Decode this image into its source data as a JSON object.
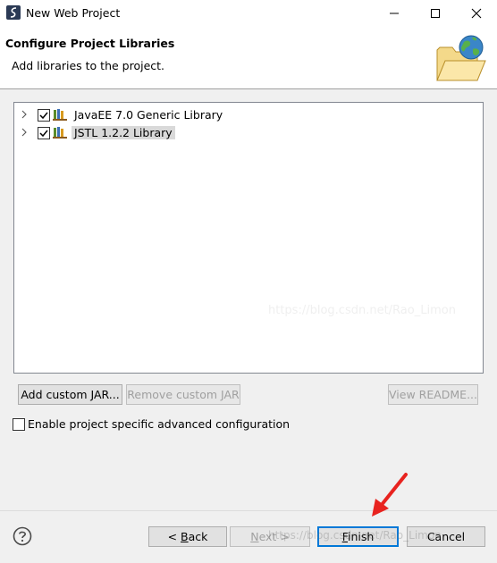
{
  "window": {
    "title": "New Web Project"
  },
  "banner": {
    "title": "Configure Project Libraries",
    "subtitle": "Add libraries to the project."
  },
  "libraries": [
    {
      "label": "JavaEE 7.0 Generic Library",
      "checked": true,
      "selected": false
    },
    {
      "label": "JSTL 1.2.2 Library",
      "checked": true,
      "selected": true
    }
  ],
  "buttons": {
    "add_custom_jar": "Add custom JAR...",
    "remove_custom_jar": "Remove custom JAR",
    "view_readme": "View README...",
    "back_pre": "< ",
    "back_mnemonic": "B",
    "back_post": "ack",
    "next_pre": "",
    "next_mnemonic": "N",
    "next_post": "ext >",
    "finish_pre": "",
    "finish_mnemonic": "F",
    "finish_post": "inish",
    "cancel": "Cancel"
  },
  "option": {
    "label": "Enable project specific advanced configuration",
    "checked": false
  },
  "watermark": "https://blog.csdn.net/Rao_Limon",
  "colors": {
    "accent": "#0078d7",
    "arrow": "#e8231f",
    "selection": "#d9d9d9"
  }
}
